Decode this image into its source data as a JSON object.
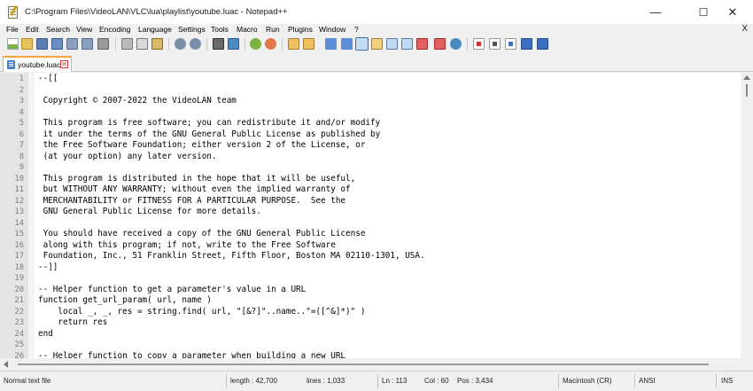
{
  "window": {
    "title": "C:\\Program Files\\VideoLAN\\VLC\\lua\\playlist\\youtube.luac - Notepad++",
    "controls": {
      "minimize": "—",
      "maximize": "☐",
      "close": "✕"
    }
  },
  "menu": {
    "items": [
      "File",
      "Edit",
      "Search",
      "View",
      "Encoding",
      "Language",
      "Settings",
      "Tools",
      "Macro",
      "Run",
      "Plugins",
      "Window",
      "?"
    ],
    "close": "X"
  },
  "toolbar": {
    "icons": [
      "new-file-icon",
      "open-file-icon",
      "save-icon",
      "save-all-icon",
      "close-icon",
      "close-all-icon",
      "print-icon",
      "cut-icon",
      "copy-icon",
      "paste-icon",
      "undo-icon",
      "redo-icon",
      "find-icon",
      "replace-icon",
      "zoom-in-icon",
      "zoom-out-icon",
      "sync-vertical-icon",
      "sync-horizontal-icon",
      "word-wrap-icon",
      "show-all-chars-icon",
      "indent-guide-icon",
      "lang-udl-icon",
      "doc-map-icon",
      "function-list-icon",
      "folder-workspace-icon",
      "monitor-icon",
      "record-macro-icon",
      "stop-record-icon",
      "play-macro-icon",
      "run-macro-multiple-icon",
      "save-macro-icon"
    ]
  },
  "tab": {
    "label": "youtube.luac",
    "close": "✕"
  },
  "editor": {
    "lines": [
      {
        "n": "1",
        "text": "--[["
      },
      {
        "n": "2",
        "text": ""
      },
      {
        "n": "3",
        "text": " Copyright © 2007-2022 the VideoLAN team"
      },
      {
        "n": "4",
        "text": ""
      },
      {
        "n": "5",
        "text": " This program is free software; you can redistribute it and/or modify"
      },
      {
        "n": "6",
        "text": " it under the terms of the GNU General Public License as published by"
      },
      {
        "n": "7",
        "text": " the Free Software Foundation; either version 2 of the License, or"
      },
      {
        "n": "8",
        "text": " (at your option) any later version."
      },
      {
        "n": "9",
        "text": ""
      },
      {
        "n": "10",
        "text": " This program is distributed in the hope that it will be useful,"
      },
      {
        "n": "11",
        "text": " but WITHOUT ANY WARRANTY; without even the implied warranty of"
      },
      {
        "n": "12",
        "text": " MERCHANTABILITY or FITNESS FOR A PARTICULAR PURPOSE.  See the"
      },
      {
        "n": "13",
        "text": " GNU General Public License for more details."
      },
      {
        "n": "14",
        "text": ""
      },
      {
        "n": "15",
        "text": " You should have received a copy of the GNU General Public License"
      },
      {
        "n": "16",
        "text": " along with this program; if not, write to the Free Software"
      },
      {
        "n": "17",
        "text": " Foundation, Inc., 51 Franklin Street, Fifth Floor, Boston MA 02110-1301, USA."
      },
      {
        "n": "18",
        "text": "--]]"
      },
      {
        "n": "19",
        "text": ""
      },
      {
        "n": "20",
        "text": "-- Helper function to get a parameter's value in a URL"
      },
      {
        "n": "21",
        "text": "function get_url_param( url, name )"
      },
      {
        "n": "22",
        "text": "    local _, _, res = string.find( url, \"[&?]\"..name..\"=([^&]*)\" )"
      },
      {
        "n": "23",
        "text": "    return res"
      },
      {
        "n": "24",
        "text": "end"
      },
      {
        "n": "25",
        "text": ""
      },
      {
        "n": "26",
        "text": "-- Helper function to copy a parameter when building a new URL"
      }
    ]
  },
  "status": {
    "file_type": "Normal text file",
    "length": "length : 42,700",
    "lines": "lines : 1,033",
    "ln": "Ln : 113",
    "col": "Col : 60",
    "pos": "Pos : 3,434",
    "eol": "Macintosh (CR)",
    "encoding": "ANSI",
    "mode": "INS"
  }
}
